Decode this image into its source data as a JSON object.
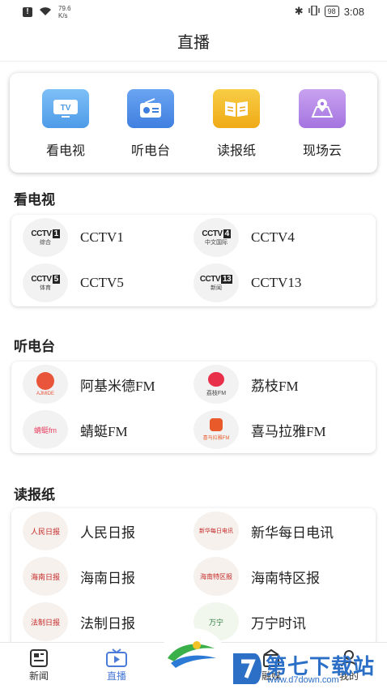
{
  "status_bar": {
    "net_speed": "79.6",
    "net_unit": "K/s",
    "battery": "98",
    "time": "3:08"
  },
  "header": {
    "title": "直播"
  },
  "quick_links": [
    {
      "label": "看电视",
      "icon": "tv-icon",
      "color": "#5aa8f0"
    },
    {
      "label": "听电台",
      "icon": "radio-icon",
      "color": "#4e8ee8"
    },
    {
      "label": "读报纸",
      "icon": "book-icon",
      "color": "#f2b626"
    },
    {
      "label": "现场云",
      "icon": "location-icon",
      "color": "#b58ae8"
    }
  ],
  "tv": {
    "title": "看电视",
    "items": [
      {
        "name": "CCTV1",
        "logo_num": "1",
        "logo_sub": "综合"
      },
      {
        "name": "CCTV4",
        "logo_num": "4",
        "logo_sub": "中文国际"
      },
      {
        "name": "CCTV5",
        "logo_num": "5",
        "logo_sub": "体育"
      },
      {
        "name": "CCTV13",
        "logo_num": "13",
        "logo_sub": "新闻"
      }
    ]
  },
  "radio": {
    "title": "听电台",
    "items": [
      {
        "name": "阿基米德FM",
        "logo_text": "AJMIDE",
        "logo_color": "#e8553a"
      },
      {
        "name": "荔枝FM",
        "logo_text": "荔枝FM",
        "logo_color": "#e8304a"
      },
      {
        "name": "蜻蜓FM",
        "logo_text": "蜻蜓fm",
        "logo_color": "#e84060"
      },
      {
        "name": "喜马拉雅FM",
        "logo_text": "喜马拉雅FM",
        "logo_color": "#e85a2a"
      }
    ]
  },
  "newspaper": {
    "title": "读报纸",
    "items": [
      {
        "name": "人民日报",
        "logo_text": "人民日报"
      },
      {
        "name": "新华每日电讯",
        "logo_text": "新华每日电讯"
      },
      {
        "name": "海南日报",
        "logo_text": "海南日报"
      },
      {
        "name": "海南特区报",
        "logo_text": "海南特区报"
      },
      {
        "name": "法制日报",
        "logo_text": "法制日报"
      },
      {
        "name": "万宁时讯",
        "logo_text": "万宁"
      }
    ]
  },
  "tabs": [
    {
      "label": "新闻",
      "icon": "news-icon",
      "active": false
    },
    {
      "label": "直播",
      "icon": "live-tv-icon",
      "active": true
    },
    {
      "label": "融媒",
      "icon": "media-icon",
      "active": false
    },
    {
      "label": "我的",
      "icon": "user-icon",
      "active": false
    }
  ],
  "watermark": {
    "text": "第七下载站",
    "url": "www.d7down.com"
  }
}
